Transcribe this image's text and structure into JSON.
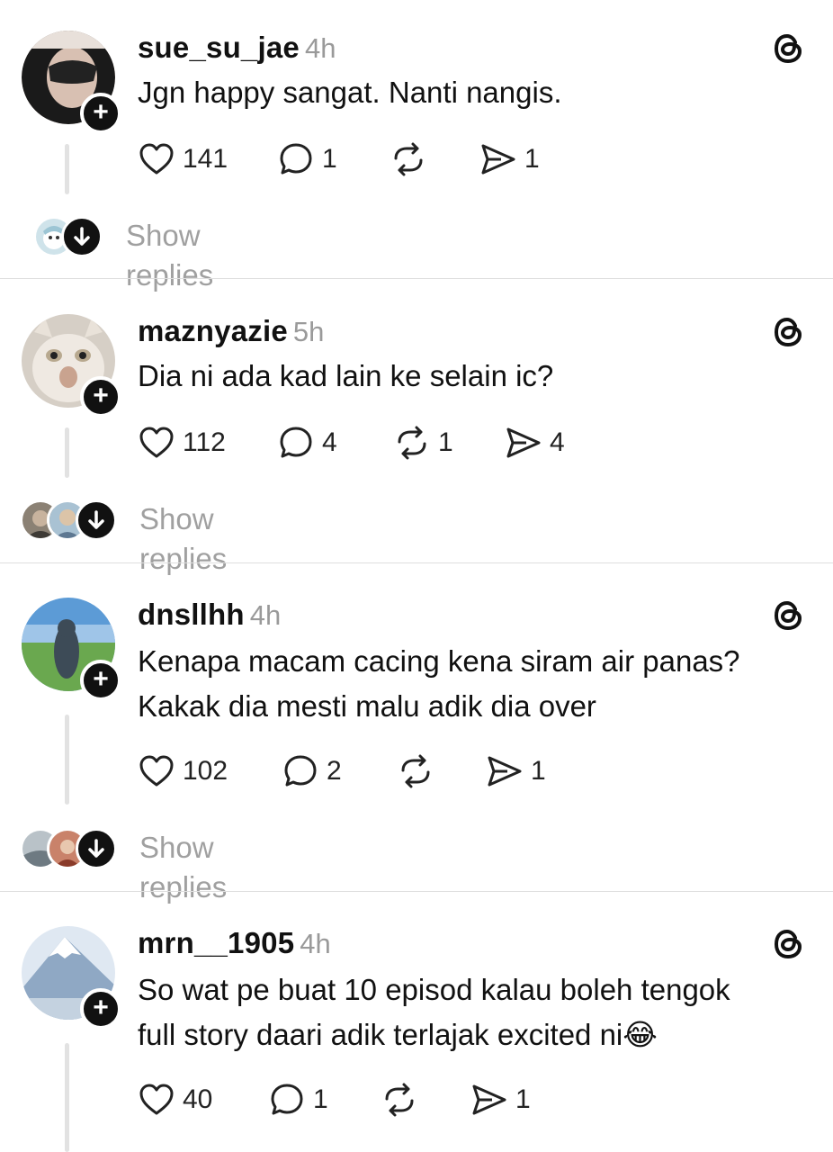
{
  "posts": [
    {
      "username": "sue_su_jae",
      "time": "4h",
      "text_lines": [
        "Jgn happy sangat. Nanti nangis."
      ],
      "likes": "141",
      "replies": "1",
      "reposts": "",
      "shares": "1",
      "show_replies": "Show replies"
    },
    {
      "username": "maznyazie",
      "time": "5h",
      "text_lines": [
        "Dia ni ada kad lain ke selain ic?"
      ],
      "likes": "112",
      "replies": "4",
      "reposts": "1",
      "shares": "4",
      "show_replies": "Show replies"
    },
    {
      "username": "dnsllhh",
      "time": "4h",
      "text_lines": [
        "Kenapa macam cacing kena siram air panas?",
        "Kakak dia mesti malu adik dia over"
      ],
      "likes": "102",
      "replies": "2",
      "reposts": "",
      "shares": "1",
      "show_replies": "Show replies"
    },
    {
      "username": "mrn__1905",
      "time": "4h",
      "text_lines": [
        "So wat pe buat 10 episod kalau boleh tengok",
        "full story daari adik terlajak excited ni😂"
      ],
      "likes": "40",
      "replies": "1",
      "reposts": "",
      "shares": "1"
    }
  ],
  "icons": {
    "like": "heart-icon",
    "reply": "speech-bubble-icon",
    "repost": "repost-icon",
    "share": "send-icon",
    "threads": "threads-logo-icon",
    "follow": "plus-icon",
    "expand": "arrow-down-icon"
  },
  "colors": {
    "text": "#111111",
    "muted": "#9a9a9a",
    "divider": "#dedede"
  }
}
